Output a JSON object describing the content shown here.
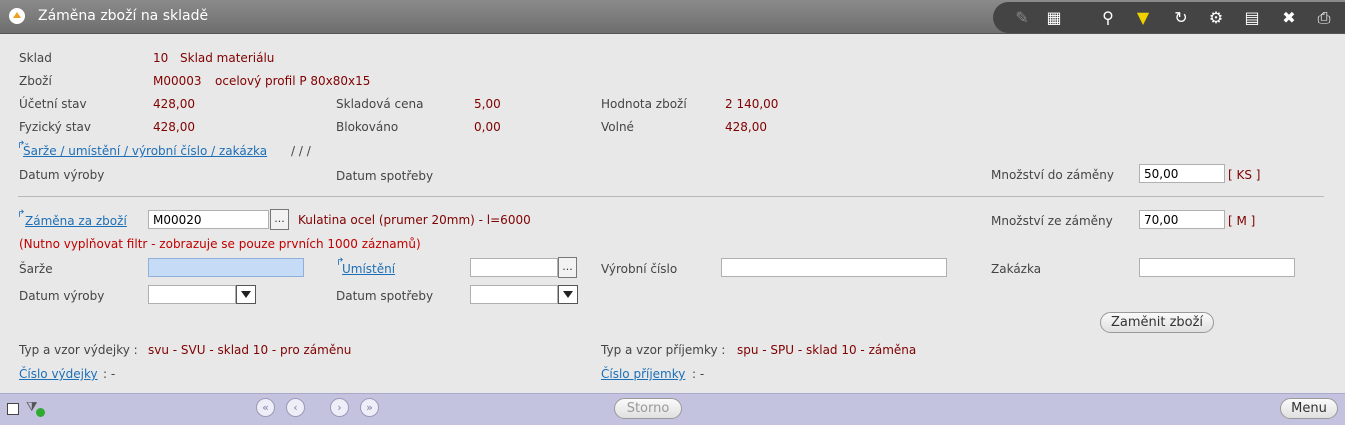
{
  "window": {
    "title": "Záměna zboží na skladě"
  },
  "toolbar": {
    "icons": [
      "edit-icon",
      "table-icon",
      "search-icon",
      "filter-icon",
      "refresh-icon",
      "user-settings-icon",
      "document-icon",
      "excel-icon",
      "print-icon"
    ]
  },
  "info": {
    "sklad_label": "Sklad",
    "sklad_code": "10",
    "sklad_name": "Sklad materiálu",
    "zbozi_label": "Zboží",
    "zbozi_code": "M00003",
    "zbozi_name": "ocelový profil P 80x80x15",
    "ucetni_label": "Účetní stav",
    "ucetni_value": "428,00",
    "fyzicky_label": "Fyzický stav",
    "fyzicky_value": "428,00",
    "skladova_label": "Skladová cena",
    "skladova_value": "5,00",
    "blokovano_label": "Blokováno",
    "blokovano_value": "0,00",
    "hodnota_label": "Hodnota zboží",
    "hodnota_value": "2 140,00",
    "volne_label": "Volné",
    "volne_value": "428,00",
    "sarze_link": "Šarže / umístění / výrobní číslo / zakázka",
    "sarze_value": "/      /      /",
    "datum_vyroby_label": "Datum výroby",
    "datum_spotreby_label": "Datum spotřeby",
    "mnozstvi_do_label": "Množství do záměny",
    "mnozstvi_do_value": "50,00",
    "mnozstvi_do_unit": "[ KS ]"
  },
  "replace": {
    "zamena_link": "Záměna za zboží",
    "zamena_code": "M00020",
    "zamena_name": "Kulatina ocel (prumer 20mm) - l=6000",
    "mnozstvi_ze_label": "Množství ze záměny",
    "mnozstvi_ze_value": "70,00",
    "mnozstvi_ze_unit": "[ M ]",
    "warning": "(Nutno vyplňovat filtr - zobrazuje se pouze prvních 1000 záznamů)",
    "sarze_label": "Šarže",
    "umisteni_link": "Umístění",
    "vyrobni_label": "Výrobní číslo",
    "zakazka_label": "Zakázka",
    "datum_vyroby_label": "Datum výroby",
    "datum_spotreby_label": "Datum spotřeby",
    "dots": "...",
    "zamenit_button": "Zaměnit zboží"
  },
  "footer_info": {
    "vydejka_label": "Typ a vzor výdejky :",
    "vydejka_value": "svu  -  SVU - sklad 10 - pro záměnu",
    "cislo_vydejky_link": "Číslo výdejky",
    "cislo_vydejky_value": ":     -",
    "prijemka_label": "Typ a vzor příjemky :",
    "prijemka_value": "spu  -  SPU - sklad 10 - záměna",
    "cislo_prijemky_link": "Číslo příjemky",
    "cislo_prijemky_value": ":     -"
  },
  "bottombar": {
    "storno_button": "Storno",
    "menu_button": "Menu",
    "nav_first": "«",
    "nav_prev": "‹",
    "nav_next": "›",
    "nav_last": "»"
  }
}
